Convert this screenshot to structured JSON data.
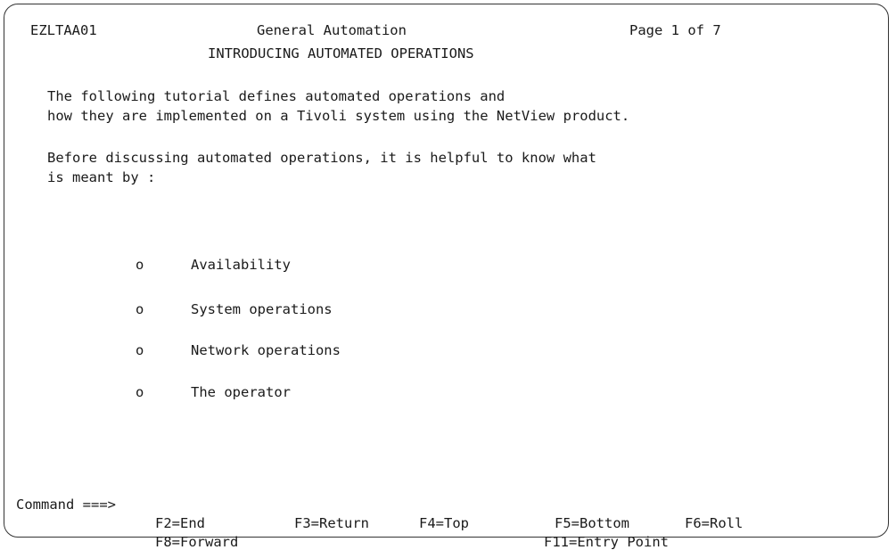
{
  "header": {
    "panel_id": "EZLTAA01",
    "app_title": "General Automation",
    "page": "Page 1 of 7",
    "subtitle": "INTRODUCING AUTOMATED OPERATIONS"
  },
  "body": {
    "intro_line1": "The following tutorial defines automated operations and",
    "intro_line2": "how they are implemented on a Tivoli system using the NetView product.",
    "before_line1": "Before discussing automated operations, it is helpful to know what",
    "before_line2": "is meant by :",
    "bullet_marker": "o",
    "items": [
      "Availability",
      "System operations",
      "Network operations",
      "The operator"
    ]
  },
  "command": {
    "label": "Command ===>",
    "value": ""
  },
  "function_keys": {
    "f2": "F2=End",
    "f3": "F3=Return",
    "f4": "F4=Top",
    "f5": "F5=Bottom",
    "f6": "F6=Roll",
    "f8": "F8=Forward",
    "f11": "F11=Entry Point"
  }
}
